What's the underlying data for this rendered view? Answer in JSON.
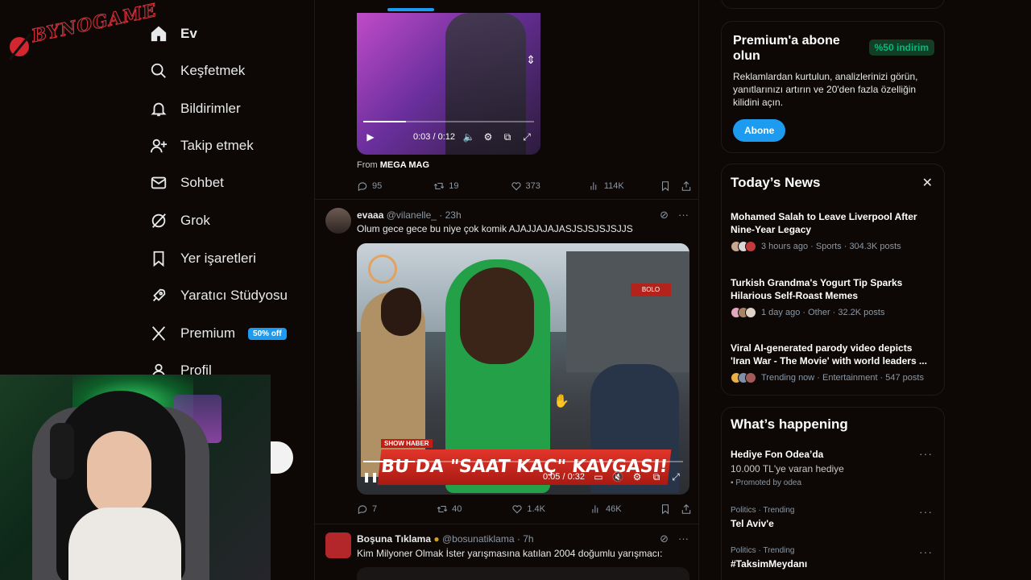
{
  "logo": {
    "text": "BYNOGAME"
  },
  "nav": {
    "items": [
      {
        "label": "Ev",
        "icon": "home-icon",
        "active": true
      },
      {
        "label": "Keşfetmek",
        "icon": "search-icon"
      },
      {
        "label": "Bildirimler",
        "icon": "bell-icon"
      },
      {
        "label": "Takip etmek",
        "icon": "add-user-icon"
      },
      {
        "label": "Sohbet",
        "icon": "mail-icon"
      },
      {
        "label": "Grok",
        "icon": "grok-icon"
      },
      {
        "label": "Yer işaretleri",
        "icon": "bookmark-icon"
      },
      {
        "label": "Yaratıcı Stüdyosu",
        "icon": "rocket-icon"
      },
      {
        "label": "Premium",
        "icon": "x-logo-icon",
        "badge": "50% off"
      },
      {
        "label": "Profil",
        "icon": "person-icon"
      }
    ]
  },
  "feed": {
    "tweet1": {
      "video_time": "0:03 / 0:12",
      "from_prefix": "From",
      "from_name": "MEGA MAG",
      "replies": "95",
      "reposts": "19",
      "likes": "373",
      "views": "114K"
    },
    "tweet2": {
      "name": "evaaa",
      "handle": "@vilanelle_",
      "time": "· 23h",
      "text": "Olum gece gece bu niye çok komik AJAJJAJAJASJSJSJSJSJJS",
      "video_caption": "BU DA \"SAAT KAÇ\" KAVGASI!",
      "video_tag": "SHOW HABER",
      "video_sign": "BOLO",
      "video_time": "0:05 / 0:32",
      "replies": "7",
      "reposts": "40",
      "likes": "1.4K",
      "views": "46K"
    },
    "tweet3": {
      "name": "Boşuna Tıklama",
      "handle": "@bosunatiklama",
      "time": "· 7h",
      "text": "Kim Milyoner Olmak İster yarışmasına katılan 2004 doğumlu yarışmacı:"
    }
  },
  "premium": {
    "title": "Premium'a abone olun",
    "badge": "%50 indirim",
    "description": "Reklamlardan kurtulun, analizlerinizi görün, yanıtlarınızı artırın ve 20'den fazla özelliğin kilidini açın.",
    "button": "Abone"
  },
  "news": {
    "title": "Today’s News",
    "items": [
      {
        "title": "Mohamed Salah to Leave Liverpool After Nine-Year Legacy",
        "meta": "3 hours ago · Sports · 304.3K posts"
      },
      {
        "title": "Turkish Grandma's Yogurt Tip Sparks Hilarious Self-Roast Memes",
        "meta": "1 day ago · Other · 32.2K posts"
      },
      {
        "title": "Viral AI-generated parody video depicts 'Iran War - The Movie' with world leaders ...",
        "meta": "Trending now · Entertainment · 547 posts"
      }
    ]
  },
  "happening": {
    "title": "What’s happening",
    "promo": {
      "name": "Hediye Fon Odea’da",
      "sub": "10.000 TL'ye varan hediye",
      "promoted": "Promoted by odea"
    },
    "trends": [
      {
        "category": "Politics · Trending",
        "name": "Tel Aviv'e"
      },
      {
        "category": "Politics · Trending",
        "name": "#TaksimMeydanı"
      }
    ]
  },
  "colors": {
    "accent": "#1d9bf0",
    "background": "#0d0806",
    "discount_green": "#00ba7c"
  }
}
